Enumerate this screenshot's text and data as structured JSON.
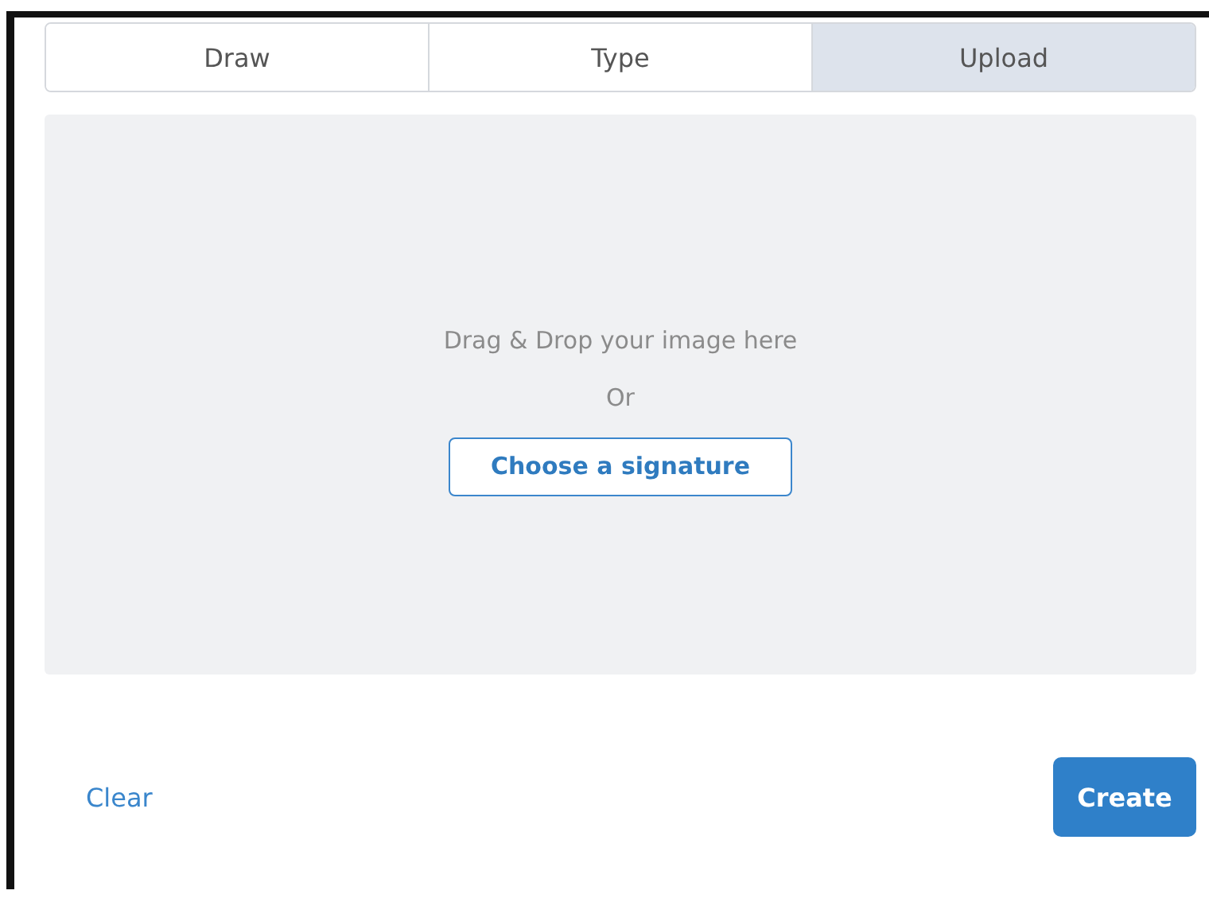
{
  "tabs": [
    {
      "label": "Draw",
      "selected": false
    },
    {
      "label": "Type",
      "selected": false
    },
    {
      "label": "Upload",
      "selected": true
    }
  ],
  "drop_zone": {
    "text": "Drag & Drop your image here",
    "separator": "Or",
    "button": "Choose a signature"
  },
  "footer": {
    "clear": "Clear",
    "create": "Create"
  }
}
